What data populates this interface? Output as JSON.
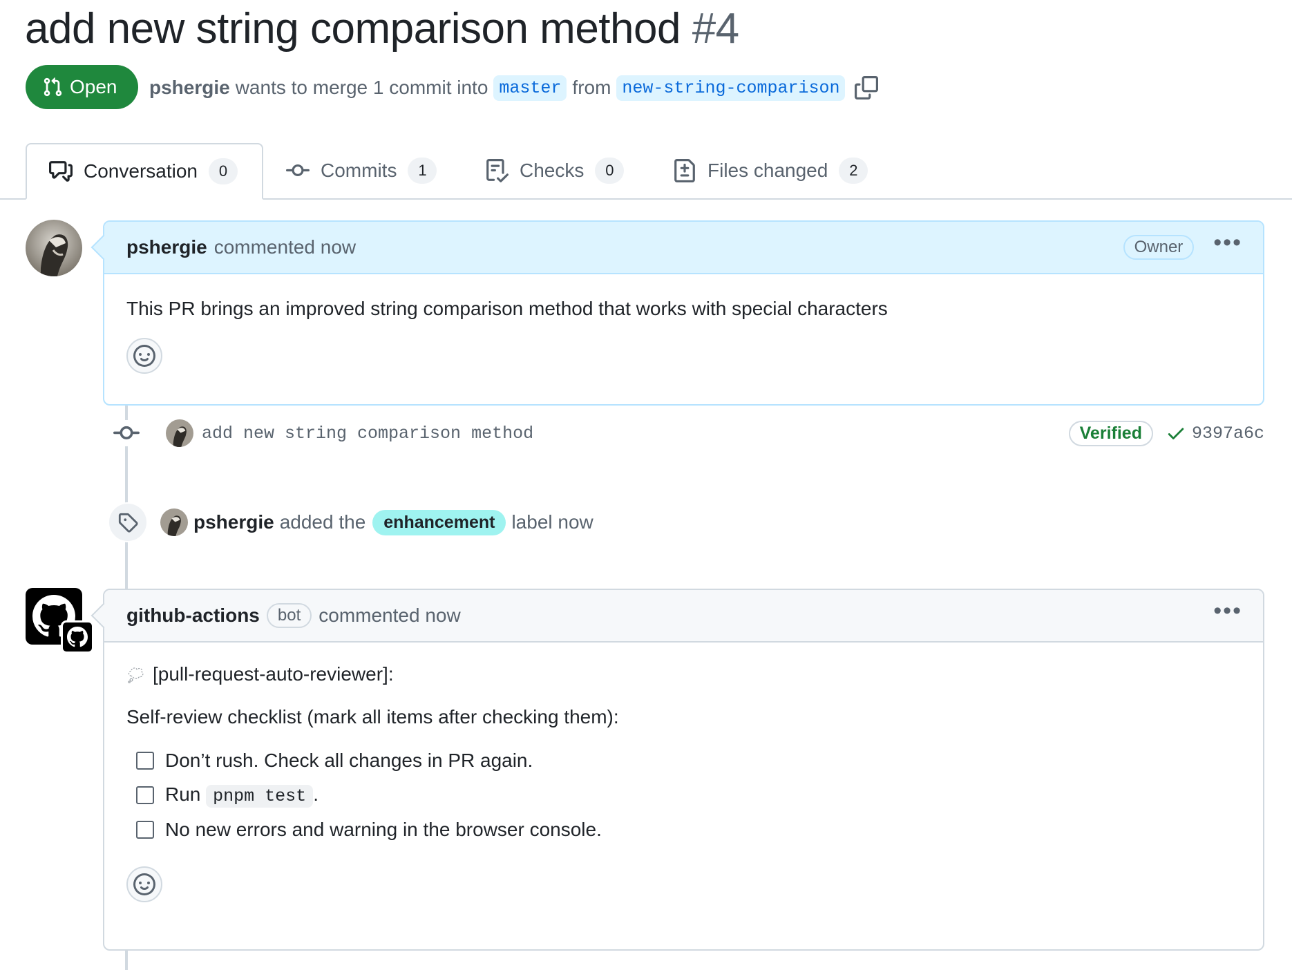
{
  "header": {
    "title": "add new string comparison method",
    "number": "#4",
    "state_label": "Open",
    "author": "pshergie",
    "merge_text": "wants to merge 1 commit into",
    "base_branch": "master",
    "from_text": "from",
    "head_branch": "new-string-comparison"
  },
  "tabs": [
    {
      "label": "Conversation",
      "count": "0"
    },
    {
      "label": "Commits",
      "count": "1"
    },
    {
      "label": "Checks",
      "count": "0"
    },
    {
      "label": "Files changed",
      "count": "2"
    }
  ],
  "comment1": {
    "author": "pshergie",
    "action": "commented now",
    "badge": "Owner",
    "body": "This PR brings an improved string comparison method that works with special characters"
  },
  "commit": {
    "message": "add new string comparison method",
    "verified": "Verified",
    "sha": "9397a6c"
  },
  "label_event": {
    "actor": "pshergie",
    "text_before": "added the",
    "label": "enhancement",
    "text_after": "label now"
  },
  "comment2": {
    "author": "github-actions",
    "bot_badge": "bot",
    "action": "commented now",
    "intro": "[pull-request-auto-reviewer]:",
    "checklist_heading": "Self-review checklist (mark all items after checking them):",
    "item1": "Don’t rush. Check all changes in PR again.",
    "item2_prefix": "Run",
    "item2_code": "pnpm test",
    "item2_suffix": ".",
    "item3": "No new errors and warning in the browser console."
  },
  "colors": {
    "open_green": "#1f883d",
    "branch_blue": "#0969da",
    "label_bg": "#9ff3f0",
    "verified_green": "#1a7f37"
  }
}
